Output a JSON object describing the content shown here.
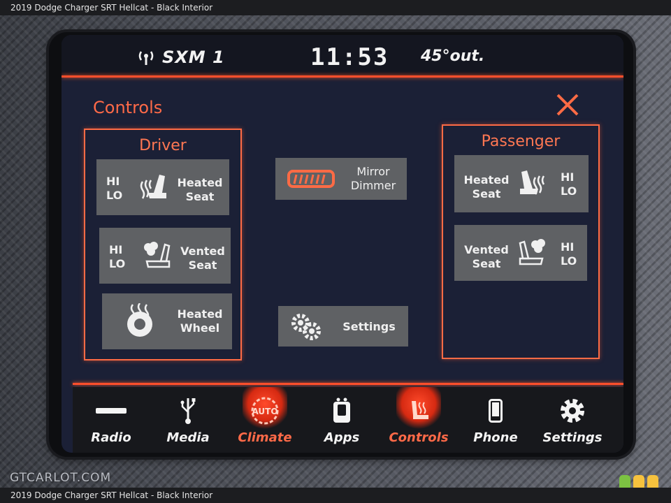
{
  "caption_top": "2019 Dodge Charger SRT Hellcat - Black Interior",
  "caption_bottom": "2019 Dodge Charger SRT Hellcat - Black Interior",
  "status": {
    "radio_icon": "antenna-icon",
    "source": "SXM 1",
    "time": "11:53",
    "temperature": "45°out."
  },
  "page_title": "Controls",
  "close_icon": "close-icon",
  "driver": {
    "title": "Driver",
    "heated_seat": {
      "hi": "HI",
      "lo": "LO",
      "label_line1": "Heated",
      "label_line2": "Seat",
      "icon": "heated-seat-icon"
    },
    "vented_seat": {
      "hi": "HI",
      "lo": "LO",
      "label_line1": "Vented",
      "label_line2": "Seat",
      "icon": "vented-seat-icon"
    },
    "heated_wheel": {
      "label_line1": "Heated",
      "label_line2": "Wheel",
      "icon": "heated-wheel-icon"
    }
  },
  "center": {
    "mirror_dimmer": {
      "label_line1": "Mirror",
      "label_line2": "Dimmer",
      "icon": "mirror-icon"
    },
    "settings": {
      "label": "Settings",
      "icon": "gears-icon"
    }
  },
  "passenger": {
    "title": "Passenger",
    "heated_seat": {
      "hi": "HI",
      "lo": "LO",
      "label_line1": "Heated",
      "label_line2": "Seat",
      "icon": "heated-seat-icon"
    },
    "vented_seat": {
      "hi": "HI",
      "lo": "LO",
      "label_line1": "Vented",
      "label_line2": "Seat",
      "icon": "vented-seat-icon"
    }
  },
  "dock": [
    {
      "label": "Radio",
      "icon": "radio-icon",
      "active": false
    },
    {
      "label": "Media",
      "icon": "usb-icon",
      "active": false
    },
    {
      "label": "Climate",
      "icon": "climate-auto-icon",
      "active": true
    },
    {
      "label": "Apps",
      "icon": "apps-icon",
      "active": false
    },
    {
      "label": "Controls",
      "icon": "controls-seat-icon",
      "active": true
    },
    {
      "label": "Phone",
      "icon": "phone-icon",
      "active": false
    },
    {
      "label": "Settings",
      "icon": "gear-icon",
      "active": false
    }
  ],
  "watermark": "GTCARLOT.COM",
  "colors": {
    "accent": "#ff5a2d",
    "screen_bg": "#1b2036",
    "tile_bg": "#5f6164"
  }
}
